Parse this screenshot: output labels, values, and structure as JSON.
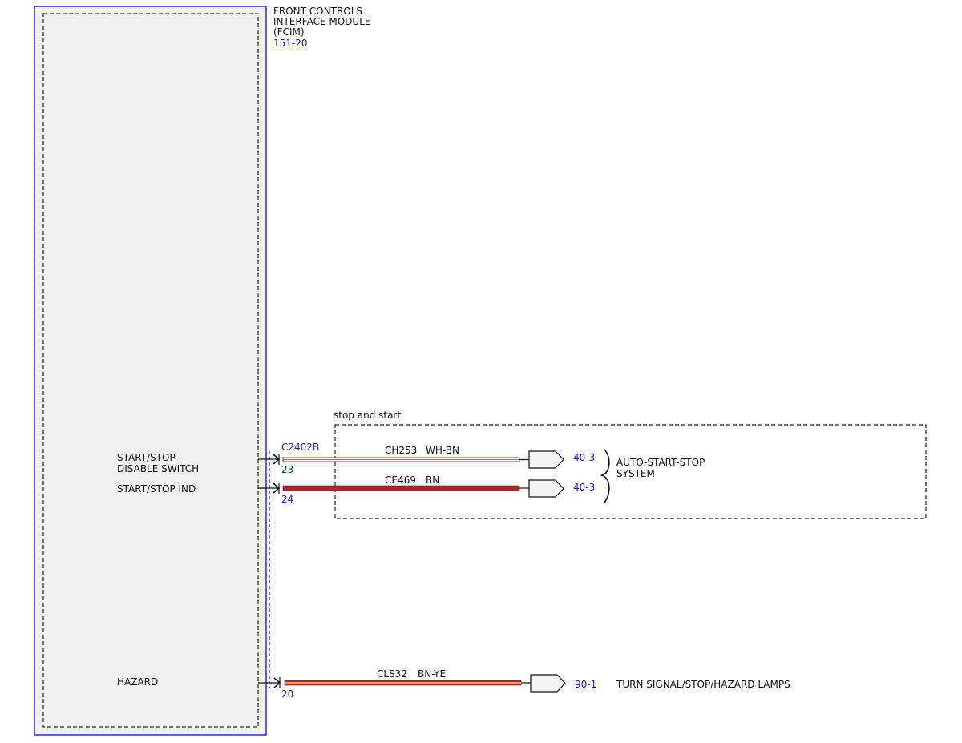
{
  "module": {
    "name_lines": [
      "FRONT CONTROLS",
      "INTERFACE MODULE",
      "(FCIM)"
    ],
    "ref": "151-20",
    "pin_labels": {
      "start_stop_disable": [
        "START/STOP",
        "DISABLE SWITCH"
      ],
      "start_stop_ind": "START/STOP IND",
      "hazard": "HAZARD"
    }
  },
  "connector": {
    "id": "C2402B"
  },
  "option_group": {
    "label": "stop and start"
  },
  "circuits": [
    {
      "pin": "23",
      "circuit": "CH253",
      "color_code": "WH-BN",
      "dest_ref": "40-3"
    },
    {
      "pin": "24",
      "circuit": "CE469",
      "color_code": "BN",
      "dest_ref": "40-3"
    },
    {
      "pin": "20",
      "circuit": "CLS32",
      "color_code": "BN-YE",
      "dest_ref": "90-1"
    }
  ],
  "destinations": {
    "auto_start_stop": [
      "AUTO-START-STOP",
      "SYSTEM"
    ],
    "turn_signal": "TURN SIGNAL/STOP/HAZARD LAMPS"
  },
  "colors": {
    "module_border": "#2a2ad8",
    "module_fill": "#f1f1f1",
    "ref_text": "#1a1ad6",
    "wire_wh": "#ffffff",
    "wire_bn": "#a52a2a",
    "wire_ye": "#f0c020"
  }
}
